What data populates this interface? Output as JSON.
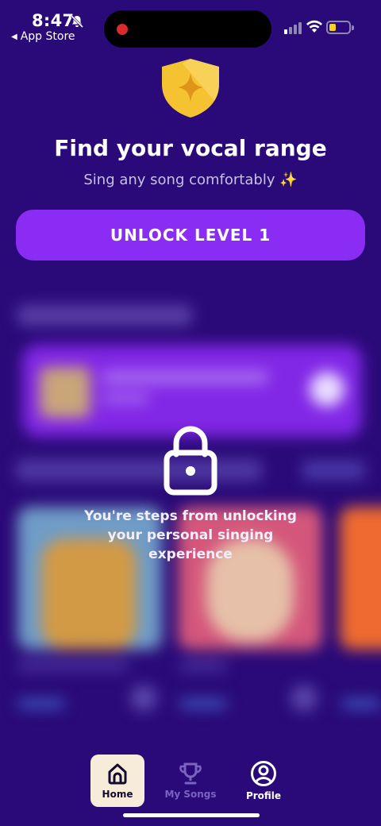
{
  "status_bar": {
    "time": "8:47",
    "back_label": "App Store",
    "icons": [
      "bell-slash-icon",
      "recording-dot-icon",
      "cell-signal-icon",
      "wifi-icon",
      "battery-icon"
    ]
  },
  "header": {
    "badge_icon": "shield-sparkle-icon",
    "title": "Find your vocal range",
    "subtitle": "Sing any song comfortably ✨",
    "cta_label": "UNLOCK LEVEL 1"
  },
  "locked": {
    "icon": "lock-icon",
    "message": "You're steps from unlocking your personal singing experience"
  },
  "nav": {
    "items": [
      {
        "label": "Home",
        "icon": "home-icon",
        "active": true
      },
      {
        "label": "My Songs",
        "icon": "trophy-icon",
        "active": false
      },
      {
        "label": "Profile",
        "icon": "profile-icon",
        "active": false
      }
    ]
  },
  "colors": {
    "background": "#2a0a78",
    "accent": "#8a2cf3",
    "shield": "#f5c232",
    "active_tab_bg": "#f6ecd9",
    "battery": "#f5d21b"
  }
}
